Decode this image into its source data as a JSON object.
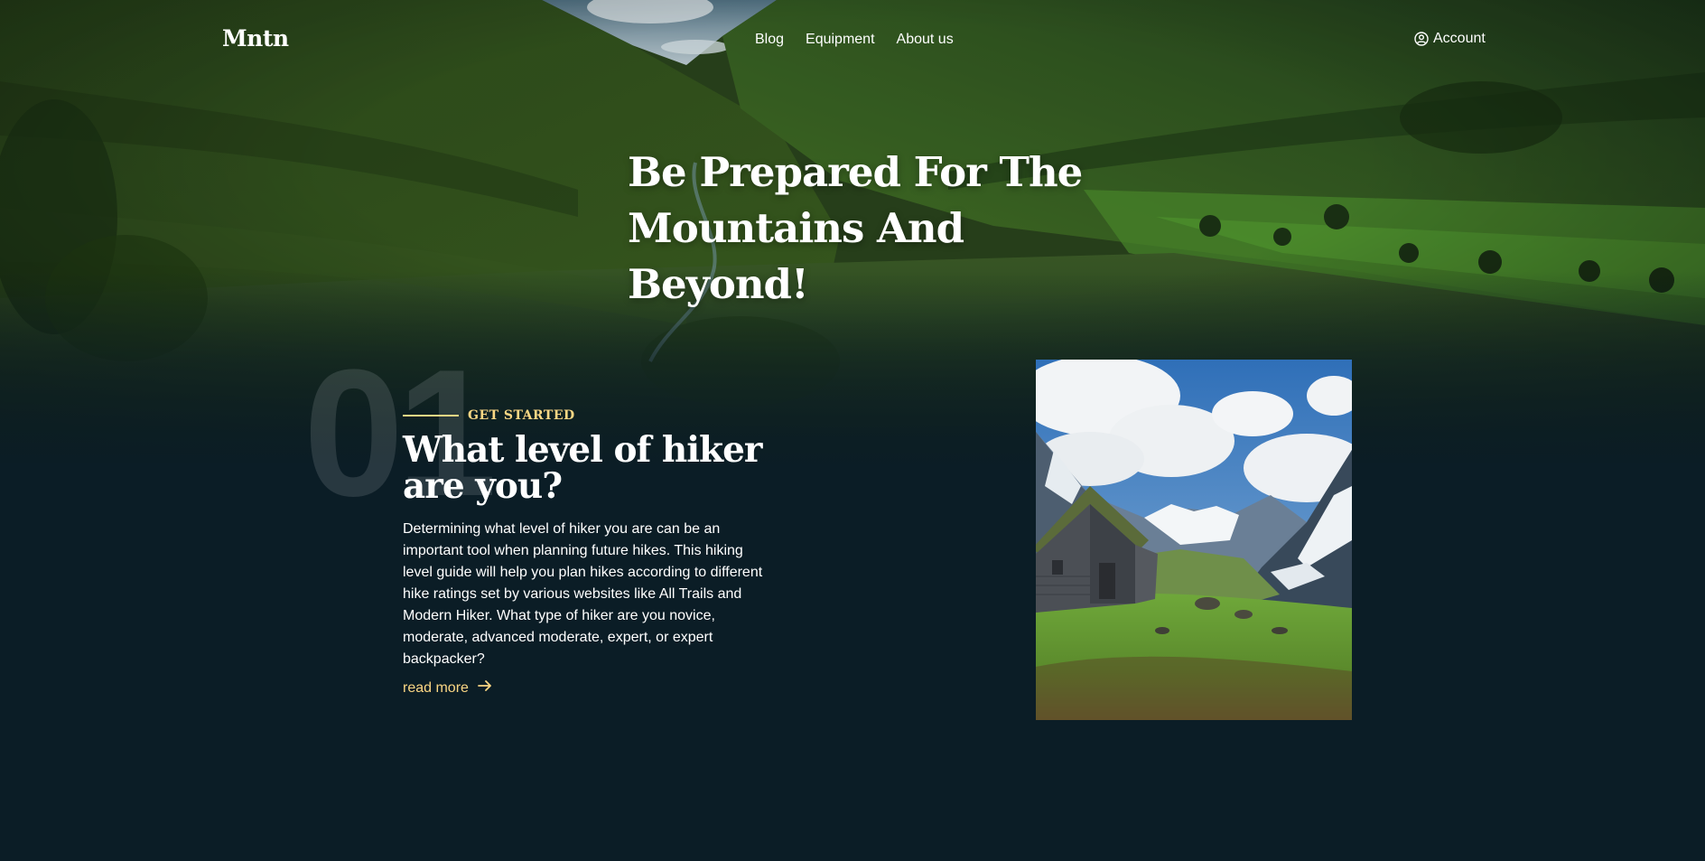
{
  "header": {
    "logo": "Mntn",
    "nav": [
      {
        "label": "Blog"
      },
      {
        "label": "Equipment"
      },
      {
        "label": "About us"
      }
    ],
    "account_label": "Account",
    "account_icon": "user-circle-icon"
  },
  "hero": {
    "title_line1": "Be Prepared For The",
    "title_line2": "Mountains And Beyond!"
  },
  "section": {
    "number": "01",
    "eyebrow": "GET STARTED",
    "title_line1": "What level of hiker",
    "title_line2": "are you?",
    "body": "Determining what level of hiker you are can be an important tool when planning future hikes. This hiking level guide will help you plan hikes according to different hike ratings set by various websites like All Trails and Modern Hiker. What type of hiker are you novice, moderate, advanced moderate, expert, or expert backpacker?",
    "read_more": "read more",
    "read_more_icon": "arrow-right-icon"
  },
  "colors": {
    "background": "#0b1d26",
    "accent": "#fbd784",
    "text": "#ffffff"
  }
}
